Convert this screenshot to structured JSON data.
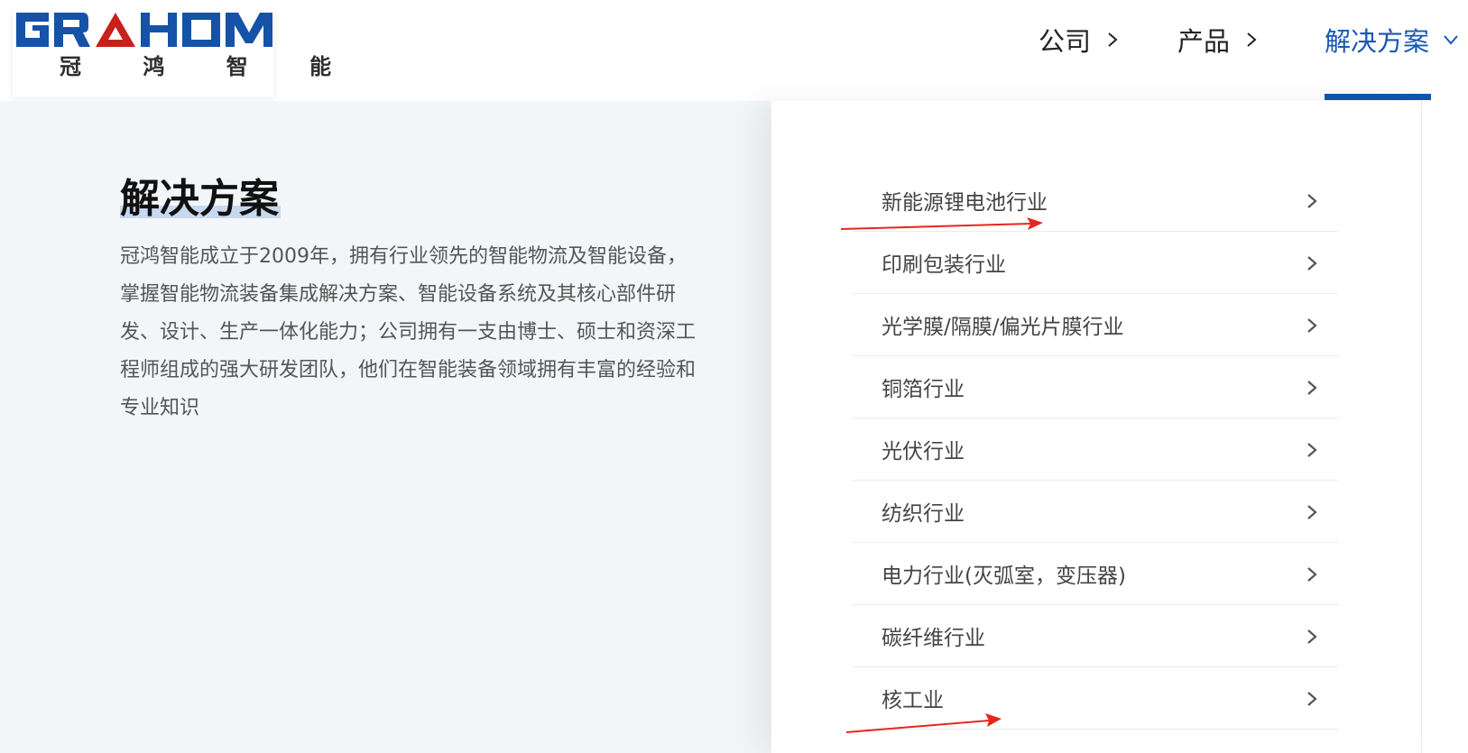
{
  "header": {
    "logo": {
      "brand": "GRAHOM",
      "chinese": "冠 鸿 智 能",
      "accent_color": "#c9201c",
      "brand_color": "#1552a8"
    },
    "nav": [
      {
        "label": "公司",
        "icon": "chevron-right-icon",
        "active": false
      },
      {
        "label": "产品",
        "icon": "chevron-right-icon",
        "active": false
      },
      {
        "label": "解决方案",
        "icon": "chevron-down-icon",
        "active": true
      }
    ],
    "active_color": "#1a57b4"
  },
  "intro": {
    "title": "解决方案",
    "description": "冠鸿智能成立于2009年，拥有行业领先的智能物流及智能设备，掌握智能物流装备集成解决方案、智能设备系统及其核心部件研发、设计、生产一体化能力；公司拥有一支由博士、硕士和资深工程师组成的强大研发团队，他们在智能装备领域拥有丰富的经验和专业知识"
  },
  "solutions_menu": [
    {
      "label": "新能源锂电池行业",
      "icon": "chevron-right-icon"
    },
    {
      "label": "印刷包装行业",
      "icon": "chevron-right-icon"
    },
    {
      "label": "光学膜/隔膜/偏光片膜行业",
      "icon": "chevron-right-icon"
    },
    {
      "label": "铜箔行业",
      "icon": "chevron-right-icon"
    },
    {
      "label": "光伏行业",
      "icon": "chevron-right-icon"
    },
    {
      "label": "纺织行业",
      "icon": "chevron-right-icon"
    },
    {
      "label": "电力行业(灭弧室，变压器)",
      "icon": "chevron-right-icon"
    },
    {
      "label": "碳纤维行业",
      "icon": "chevron-right-icon"
    },
    {
      "label": "核工业",
      "icon": "chevron-right-icon"
    }
  ],
  "annotation_color": "#e8261f"
}
